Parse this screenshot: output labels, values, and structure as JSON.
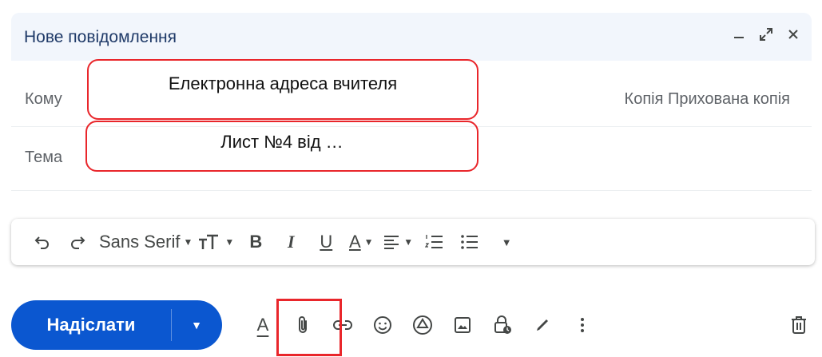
{
  "header": {
    "title": "Нове повідомлення"
  },
  "fields": {
    "to_label": "Кому",
    "to_value": "Електронна адреса вчителя",
    "subject_label": "Тема",
    "subject_value": "Лист №4 від …",
    "cc_bcc": "Копія Прихована копія"
  },
  "toolbar": {
    "font_name": "Sans Serif",
    "bold": "B",
    "italic": "I",
    "underline": "U",
    "text_color": "A"
  },
  "bottom": {
    "send_label": "Надіслати",
    "format_label": "A"
  },
  "colors": {
    "accent": "#0b57d0",
    "highlight": "#e9262b",
    "header_bg": "#f2f6fc"
  }
}
